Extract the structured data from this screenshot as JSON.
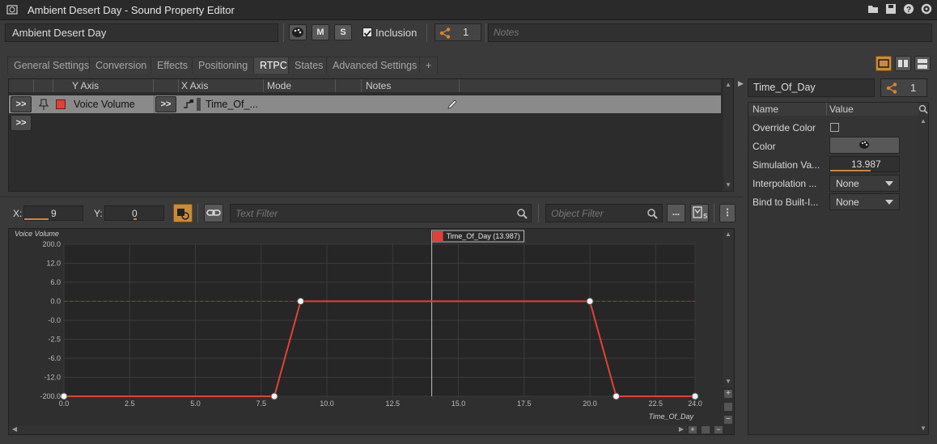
{
  "window": {
    "title": "Ambient Desert Day - Sound Property Editor"
  },
  "toolbar": {
    "object_name": "Ambient Desert Day",
    "mute_label": "M",
    "solo_label": "S",
    "inclusion_label": "Inclusion",
    "inclusion_checked": true,
    "references_count": "1",
    "notes_placeholder": "Notes"
  },
  "tabs": [
    {
      "label": "General Settings",
      "active": false
    },
    {
      "label": "Conversion",
      "active": false
    },
    {
      "label": "Effects",
      "active": false
    },
    {
      "label": "Positioning",
      "active": false
    },
    {
      "label": "RTPC",
      "active": true
    },
    {
      "label": "States",
      "active": false
    },
    {
      "label": "Advanced Settings",
      "active": false
    },
    {
      "label": "+",
      "active": false
    }
  ],
  "rtpc_table": {
    "columns": {
      "y_axis": "Y Axis",
      "x_axis": "X Axis",
      "mode": "Mode",
      "notes": "Notes"
    },
    "row": {
      "expand_label": ">>",
      "y_axis": "Voice Volume",
      "y_color": "#e0403a",
      "x_button": ">>",
      "x_axis": "Time_Of_..."
    },
    "add_label": ">>"
  },
  "graph_toolbar": {
    "x_label": "X:",
    "x_value": "9",
    "y_label": "Y:",
    "y_value": "0",
    "text_filter_placeholder": "Text Filter",
    "object_filter_placeholder": "Object Filter",
    "more_label": "..."
  },
  "chart_data": {
    "type": "line",
    "ylabel": "Voice Volume",
    "xlabel": "Time_Of_Day",
    "y_ticks": [
      "200.0",
      "12.0",
      "6.0",
      "0.0",
      "-0.0",
      "-2.5",
      "-6.0",
      "-12.0",
      "-200.0"
    ],
    "x_ticks": [
      "0.0",
      "2.5",
      "5.0",
      "7.5",
      "10.0",
      "12.5",
      "15.0",
      "17.5",
      "20.0",
      "22.5",
      "24.0"
    ],
    "xlim": [
      0,
      24
    ],
    "series": [
      {
        "points": [
          [
            0,
            -200
          ],
          [
            8,
            -200
          ],
          [
            9,
            0
          ],
          [
            20,
            0
          ],
          [
            21,
            -200
          ],
          [
            24,
            -200
          ]
        ],
        "color": "#e04238"
      }
    ],
    "cursor": {
      "x": 13.987,
      "label": "Time_Of_Day (13.987)"
    },
    "zero_line": true,
    "grid": true
  },
  "right_panel": {
    "parameter_name": "Time_Of_Day",
    "references_count": "1",
    "columns": {
      "name": "Name",
      "value": "Value"
    },
    "properties": [
      {
        "name": "Override Color",
        "value": ""
      },
      {
        "name": "Color",
        "value": ""
      },
      {
        "name": "Simulation Va...",
        "value": "13.987"
      },
      {
        "name": "Interpolation ...",
        "value": "None"
      },
      {
        "name": "Bind to Built-I...",
        "value": "None"
      }
    ],
    "simulation_fraction": 0.583
  },
  "colors": {
    "accent": "#c98b3a",
    "curve": "#e04238"
  }
}
